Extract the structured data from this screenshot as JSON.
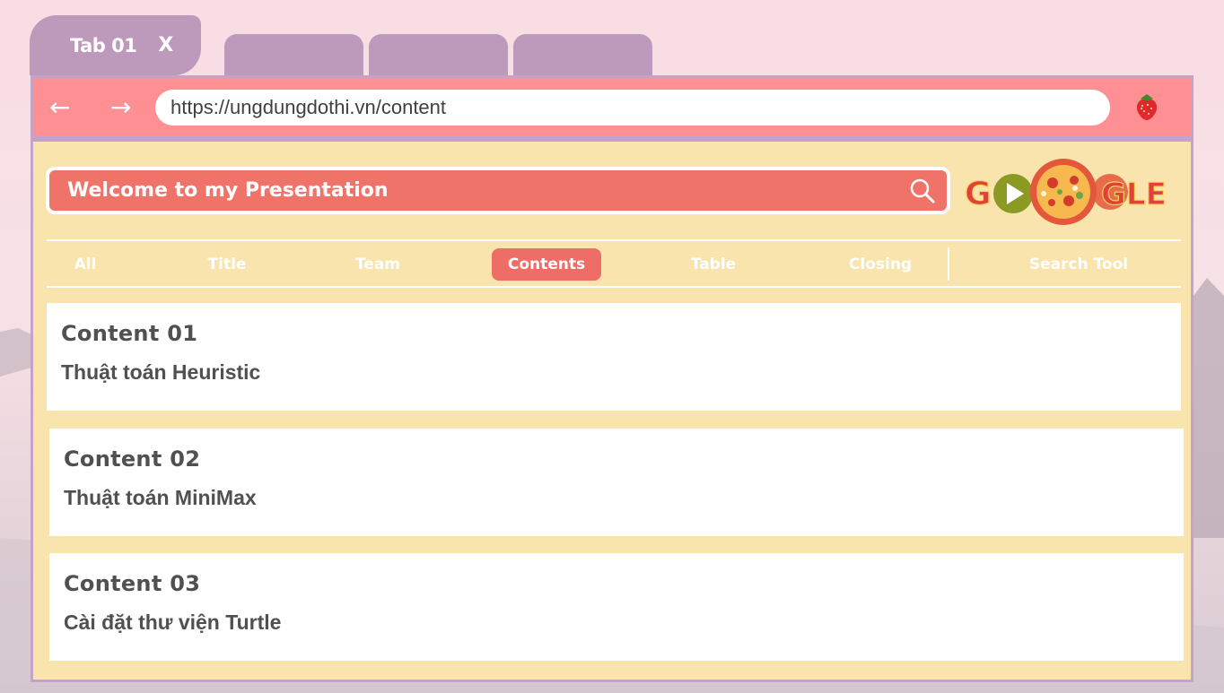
{
  "browser": {
    "active_tab_label": "Tab 01",
    "tab_close": "X",
    "back_arrow": "←",
    "forward_arrow": "→",
    "url": "https://ungdungdothi.vn/content",
    "extension_icon": "strawberry-icon"
  },
  "search": {
    "title": "Welcome to my Presentation",
    "icon": "search-icon"
  },
  "doodle": {
    "icon": "google-doodle-logo"
  },
  "menu": {
    "items": [
      "All",
      "Title",
      "Team",
      "Contents",
      "Table",
      "Closing"
    ],
    "active": "Contents",
    "tool": "Search Tool"
  },
  "cards": [
    {
      "heading": "Content 01",
      "text": "Thuật toán Heuristic"
    },
    {
      "heading": "Content 02",
      "text": "Thuật toán MiniMax"
    },
    {
      "heading": "Content 03",
      "text": "Cài đặt thư viện Turtle"
    }
  ],
  "colors": {
    "tab": "#bd9abb",
    "address_bar": "#fe8f93",
    "content_bg": "#f9e4ad",
    "accent": "#f0736a",
    "text": "#505050"
  }
}
